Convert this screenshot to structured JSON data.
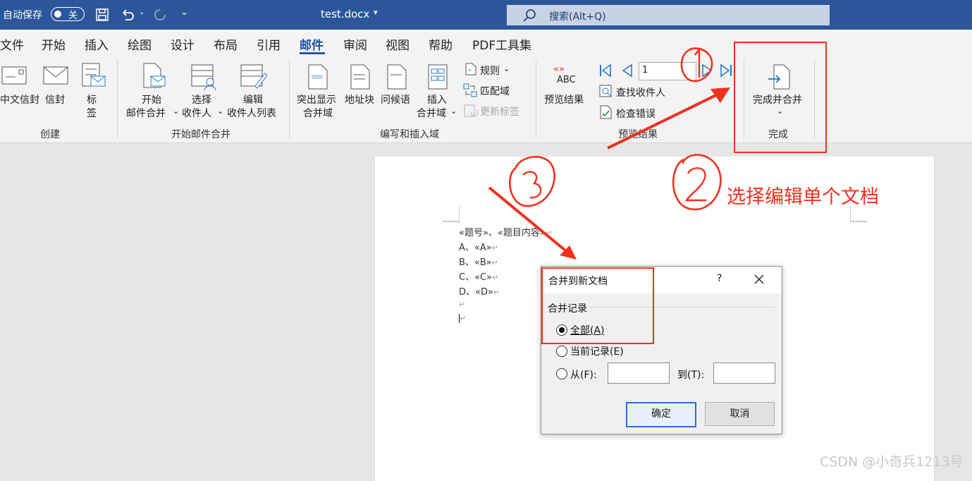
{
  "titlebar": {
    "autosave_label": "自动保存",
    "autosave_state": "关",
    "filename": "test.docx",
    "search_placeholder": "搜索(Alt+Q)"
  },
  "tabs": [
    "文件",
    "开始",
    "插入",
    "绘图",
    "设计",
    "布局",
    "引用",
    "邮件",
    "审阅",
    "视图",
    "帮助",
    "PDF工具集"
  ],
  "active_tab": "邮件",
  "ribbon": {
    "create": {
      "group_label": "创建",
      "buttons": [
        "中文信封",
        "信封",
        "标",
        "签"
      ]
    },
    "start_merge": {
      "group_label": "开始邮件合并",
      "start": [
        "开始",
        "邮件合并"
      ],
      "select": [
        "选择",
        "收件人"
      ],
      "edit": [
        "编辑",
        "收件人列表"
      ]
    },
    "write_insert": {
      "group_label": "编写和插入域",
      "highlight": [
        "突出显示",
        "合并域"
      ],
      "address_block": "地址块",
      "greeting": "问候语",
      "insert_field": [
        "插入",
        "合并域"
      ],
      "rules": "规则",
      "match_fields": "匹配域",
      "update_labels": "更新标签"
    },
    "preview": {
      "group_label": "预览结果",
      "preview_button": "预览结果",
      "abc": "ABC",
      "record_number": "1",
      "find_recipient": "查找收件人",
      "check_errors": "检查错误"
    },
    "finish": {
      "group_label": "完成",
      "finish_merge": "完成并合并"
    }
  },
  "document": {
    "lines": [
      "«题号»、«题目内容»",
      "A、«A»",
      "B、«B»",
      "C、«C»",
      "D、«D»"
    ],
    "pilcrow": "↵"
  },
  "dialog": {
    "title": "合并到新文档",
    "help": "?",
    "section_label": "合并记录",
    "option_all": "全部(A)",
    "option_current": "当前记录(E)",
    "option_from": "从(F):",
    "to_label": "到(T):",
    "from_value": "",
    "to_value": "",
    "selected": "all",
    "ok_label": "确定",
    "cancel_label": "取消"
  },
  "annotations": {
    "note": "选择编辑单个文档"
  },
  "watermark": "CSDN @小奇兵1213号",
  "colors": {
    "titlebar": "#2b579a",
    "annotation_red": "#f0311e",
    "ribbon_bg": "#f3f3f3"
  }
}
